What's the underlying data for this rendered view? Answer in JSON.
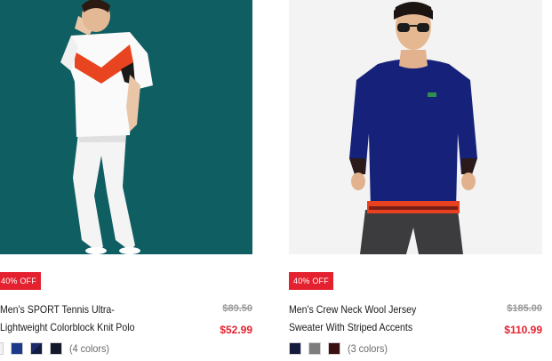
{
  "products": [
    {
      "badge": "40% OFF",
      "name_line1": "Men's SPORT Tennis Ultra-",
      "name_line2": "Lightweight Colorblock Knit Polo",
      "price_was": "$89.50",
      "price_now": "$52.99",
      "colors_count": "(4 colors)",
      "swatches": [
        "#f2f2f2",
        "#1d3a8a",
        "#1a2456",
        "#13182c"
      ]
    },
    {
      "badge": "40% OFF",
      "name_line1": "Men's Crew Neck Wool Jersey",
      "name_line2": "Sweater With Striped Accents",
      "price_was": "$185.00",
      "price_now": "$110.99",
      "colors_count": "(3 colors)",
      "swatches": [
        "#141b3c",
        "#7d7d7d",
        "#3a1010"
      ]
    }
  ],
  "colors": {
    "sale_red": "#e4222f",
    "strike_gray": "#9a9a9a",
    "teal_background": "#0f5e62"
  }
}
